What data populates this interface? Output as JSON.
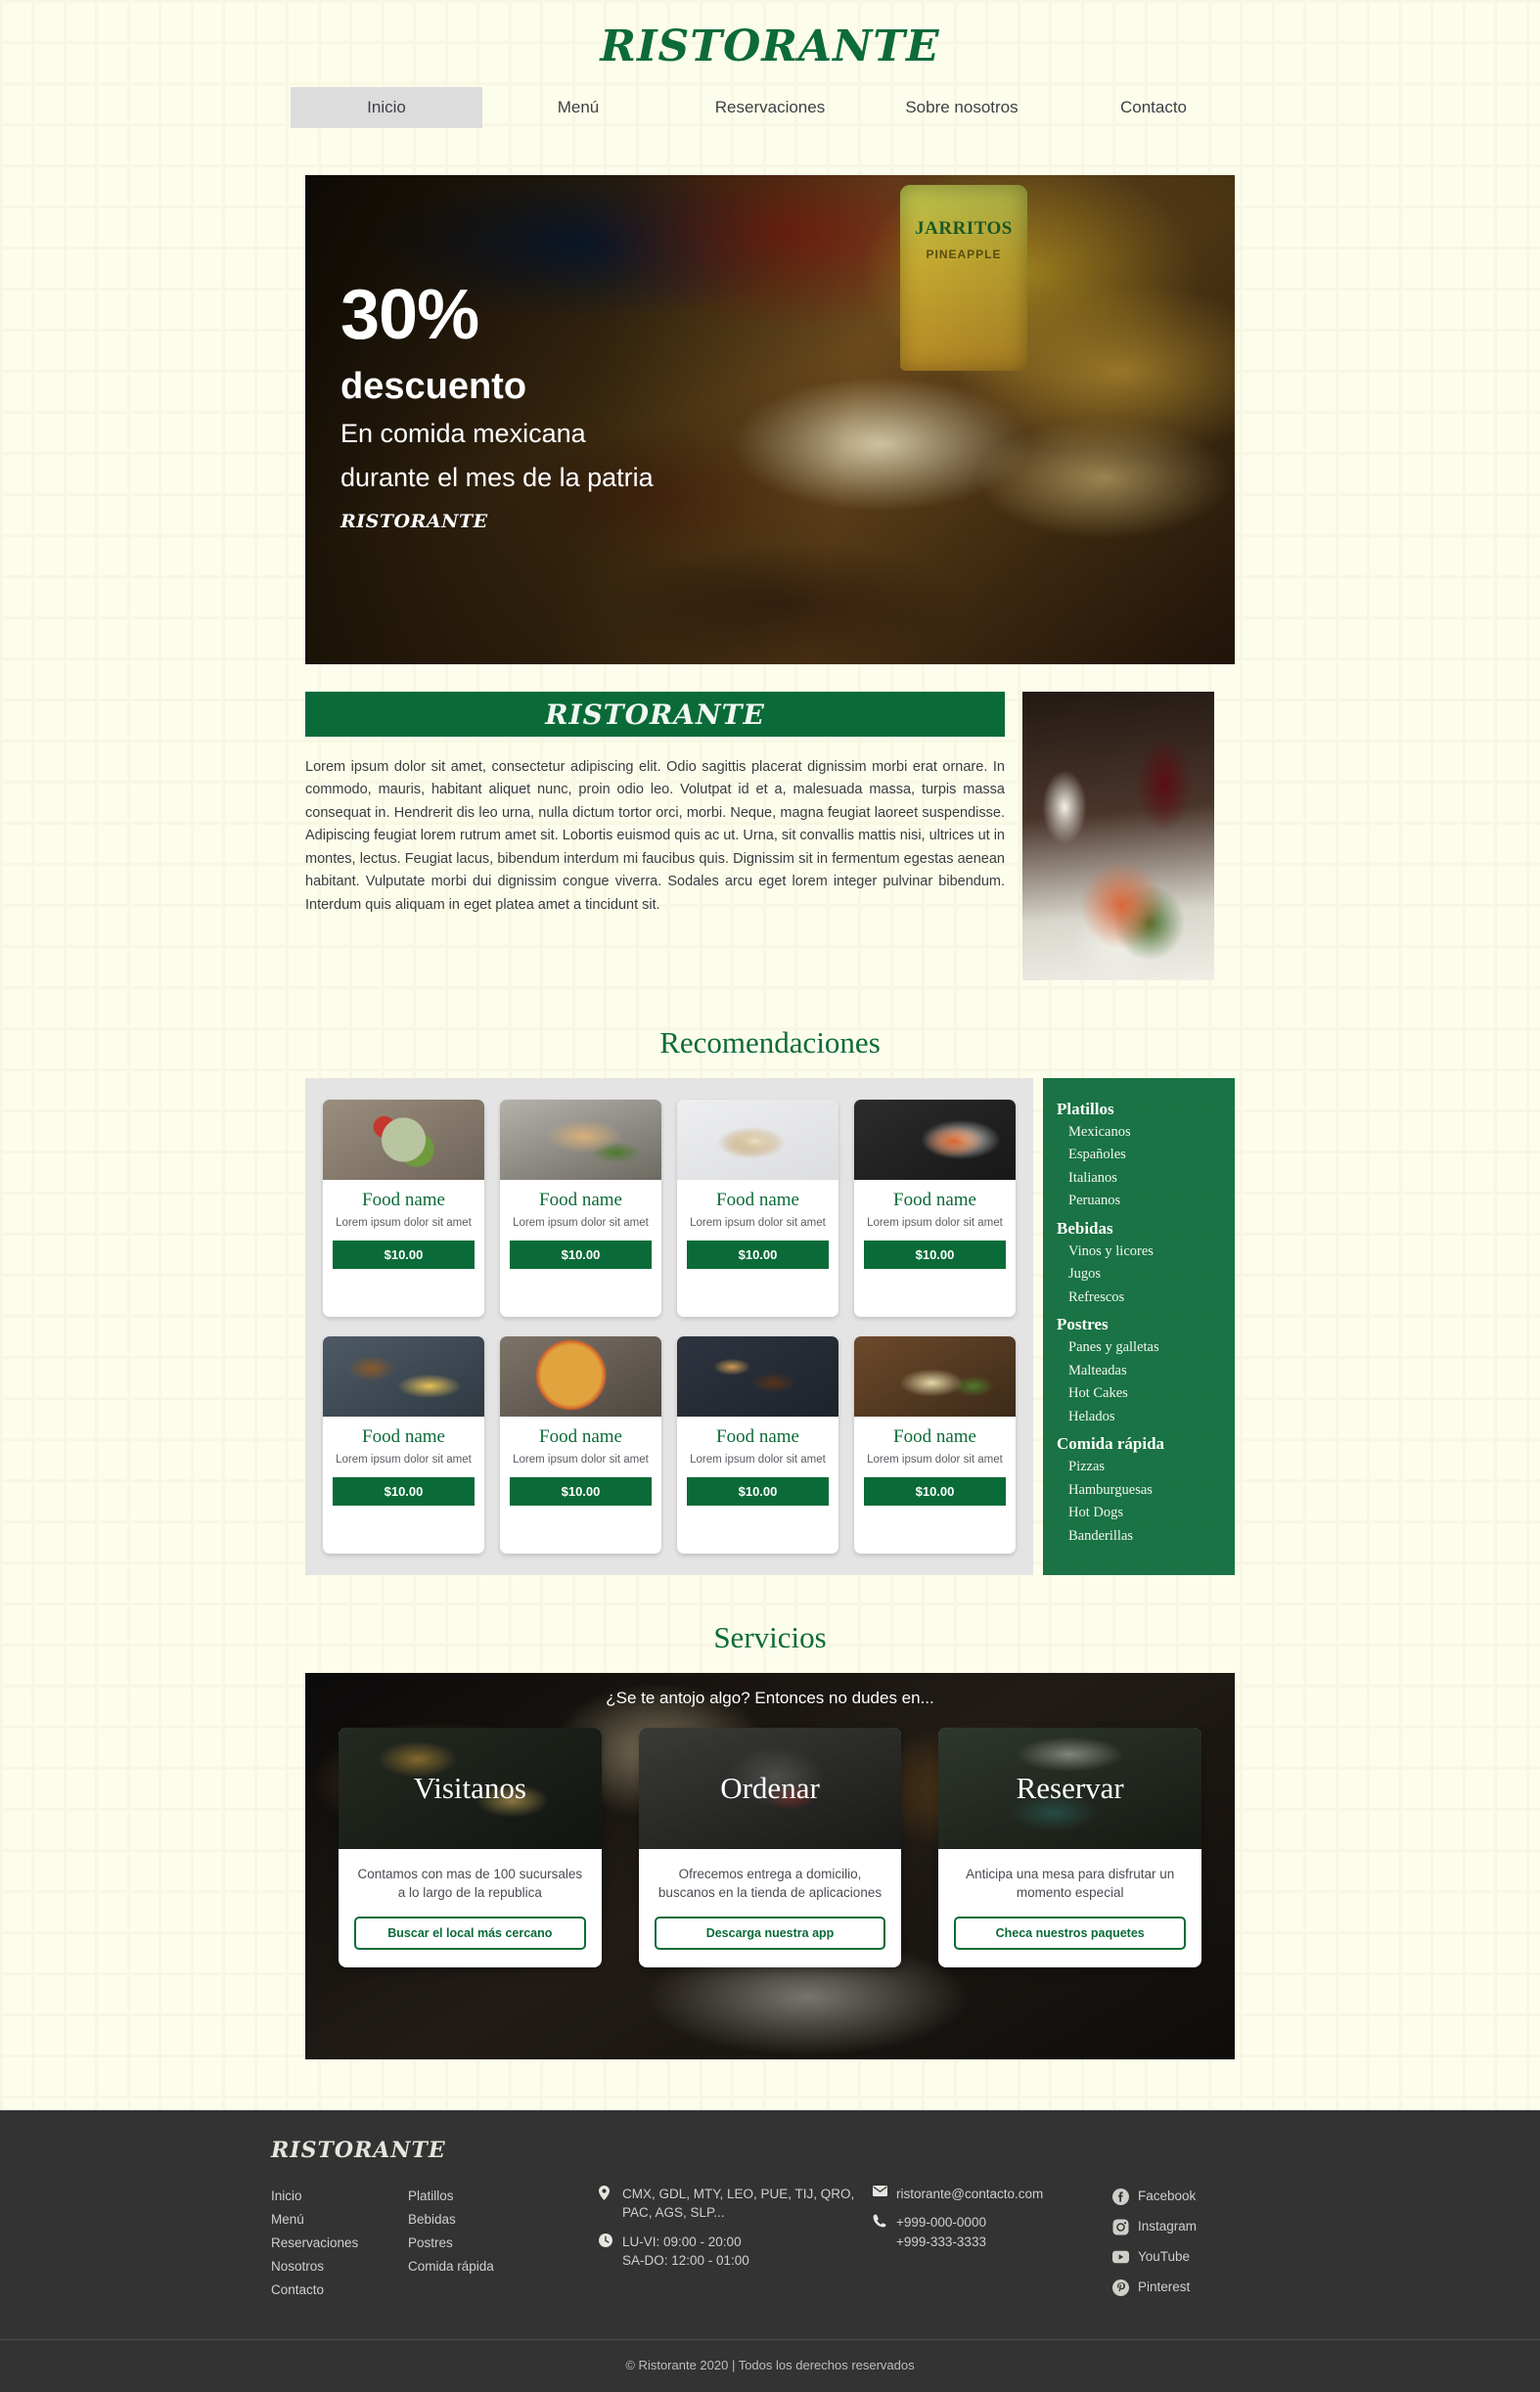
{
  "brand": {
    "name": "RISTORANTE",
    "accent_green": "#0a6b38",
    "bg_cream": "#fdfdeb",
    "footer_dark": "#333333"
  },
  "nav": {
    "items": [
      {
        "label": "Inicio",
        "active": true
      },
      {
        "label": "Menú",
        "active": false
      },
      {
        "label": "Reservaciones",
        "active": false
      },
      {
        "label": "Sobre nosotros",
        "active": false
      },
      {
        "label": "Contacto",
        "active": false
      }
    ]
  },
  "hero": {
    "percent": "30%",
    "discount_word": "descuento",
    "line1": "En comida mexicana",
    "line2": "durante el mes de la patria",
    "logo": "RISTORANTE",
    "bottle_label": "JARRITOS",
    "bottle_flavor": "PINEAPPLE"
  },
  "about": {
    "banner_logo": "RISTORANTE",
    "paragraph": "Lorem ipsum dolor sit amet, consectetur adipiscing elit. Odio sagittis placerat dignissim morbi erat ornare. In commodo, mauris, habitant aliquet nunc, proin odio leo. Volutpat id et a, malesuada massa, turpis massa consequat in. Hendrerit dis leo urna, nulla dictum tortor orci, morbi. Neque, magna feugiat laoreet suspendisse. Adipiscing feugiat lorem rutrum amet sit. Lobortis euismod quis ac ut. Urna, sit convallis mattis nisi, ultrices ut in montes, lectus. Feugiat lacus, bibendum interdum mi faucibus quis. Dignissim sit in fermentum egestas aenean habitant. Vulputate morbi dui dignissim congue viverra. Sodales arcu eget lorem integer pulvinar bibendum. Interdum quis aliquam in eget platea amet a tincidunt sit."
  },
  "recommendations": {
    "title": "Recomendaciones",
    "cards": [
      {
        "name": "Food name",
        "desc": "Lorem ipsum dolor sit amet",
        "price": "$10.00",
        "thumb": "t-salad"
      },
      {
        "name": "Food name",
        "desc": "Lorem ipsum dolor sit amet",
        "price": "$10.00",
        "thumb": "t-pork"
      },
      {
        "name": "Food name",
        "desc": "Lorem ipsum dolor sit amet",
        "price": "$10.00",
        "thumb": "t-dumpling"
      },
      {
        "name": "Food name",
        "desc": "Lorem ipsum dolor sit amet",
        "price": "$10.00",
        "thumb": "t-curry"
      },
      {
        "name": "Food name",
        "desc": "Lorem ipsum dolor sit amet",
        "price": "$10.00",
        "thumb": "t-burger"
      },
      {
        "name": "Food name",
        "desc": "Lorem ipsum dolor sit amet",
        "price": "$10.00",
        "thumb": "t-pizza"
      },
      {
        "name": "Food name",
        "desc": "Lorem ipsum dolor sit amet",
        "price": "$10.00",
        "thumb": "t-pancake"
      },
      {
        "name": "Food name",
        "desc": "Lorem ipsum dolor sit amet",
        "price": "$10.00",
        "thumb": "t-seafood"
      }
    ],
    "categories": [
      {
        "head": "Platillos",
        "items": [
          "Mexicanos",
          "Españoles",
          "Italianos",
          "Peruanos"
        ]
      },
      {
        "head": "Bebidas",
        "items": [
          "Vinos y licores",
          "Jugos",
          "Refrescos"
        ]
      },
      {
        "head": "Postres",
        "items": [
          "Panes y galletas",
          "Malteadas",
          "Hot Cakes",
          "Helados"
        ]
      },
      {
        "head": "Comida rápida",
        "items": [
          "Pizzas",
          "Hamburguesas",
          "Hot Dogs",
          "Banderillas"
        ]
      }
    ]
  },
  "services": {
    "title": "Servicios",
    "tagline": "¿Se te antojo algo? Entonces no dudes en...",
    "cards": [
      {
        "title": "Visitanos",
        "desc": "Contamos con mas de 100 sucursales a lo largo de la republica",
        "button": "Buscar el local más cercano",
        "photo": "h-visit"
      },
      {
        "title": "Ordenar",
        "desc": "Ofrecemos entrega a domicilio, buscanos en la tienda de aplicaciones",
        "button": "Descarga nuestra app",
        "photo": "h-order"
      },
      {
        "title": "Reservar",
        "desc": "Anticipa una mesa para disfrutar un momento especial",
        "button": "Checa nuestros paquetes",
        "photo": "h-reserve"
      }
    ]
  },
  "footer": {
    "logo": "RISTORANTE",
    "links": [
      "Inicio",
      "Menú",
      "Reservaciones",
      "Nosotros",
      "Contacto"
    ],
    "menu_links": [
      "Platillos",
      "Bebidas",
      "Postres",
      "Comida rápida"
    ],
    "locations": "CMX, GDL, MTY, LEO, PUE, TIJ, QRO, PAC, AGS, SLP...",
    "hours_line1": "LU-VI: 09:00 - 20:00",
    "hours_line2": "SA-DO: 12:00 - 01:00",
    "email": "ristorante@contacto.com",
    "phone1": "+999-000-0000",
    "phone2": "+999-333-3333",
    "social": [
      {
        "label": "Facebook",
        "icon": "facebook-icon"
      },
      {
        "label": "Instagram",
        "icon": "instagram-icon"
      },
      {
        "label": "YouTube",
        "icon": "youtube-icon"
      },
      {
        "label": "Pinterest",
        "icon": "pinterest-icon"
      }
    ],
    "copyright": "© Ristorante 2020 | Todos los derechos reservados"
  }
}
